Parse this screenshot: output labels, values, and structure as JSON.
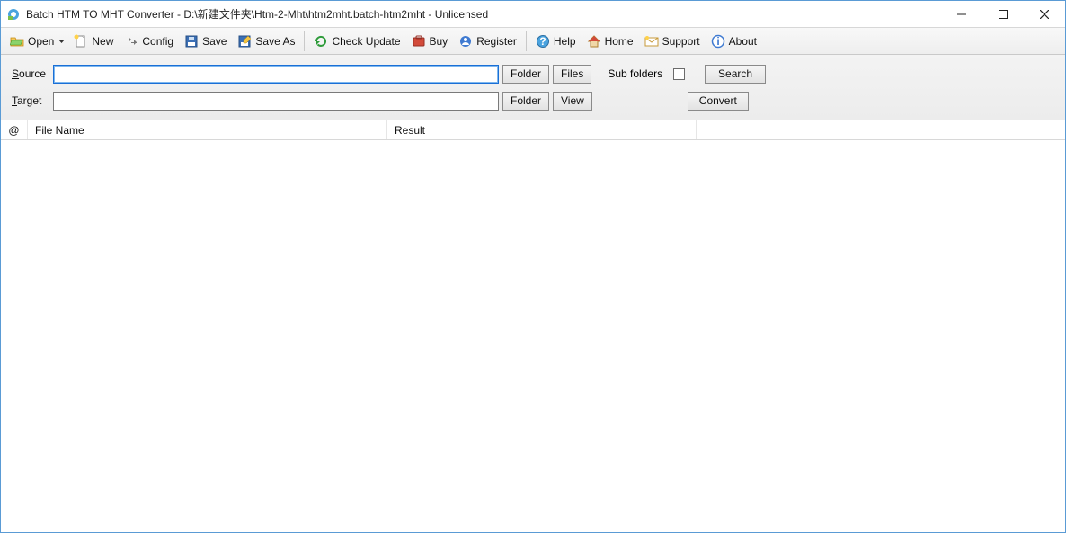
{
  "window": {
    "title": "Batch HTM TO MHT Converter - D:\\新建文件夹\\Htm-2-Mht\\htm2mht.batch-htm2mht - Unlicensed"
  },
  "toolbar": {
    "open": "Open",
    "new": "New",
    "config": "Config",
    "save": "Save",
    "save_as": "Save As",
    "check_update": "Check Update",
    "buy": "Buy",
    "register": "Register",
    "help": "Help",
    "home": "Home",
    "support": "Support",
    "about": "About"
  },
  "form": {
    "source_label_pre": "S",
    "source_label_post": "ource",
    "source_value": "",
    "target_label_pre": "T",
    "target_label_post": "arget",
    "target_value": "",
    "folder_btn": "Folder",
    "files_btn": "Files",
    "view_btn": "View",
    "subfolders_label": "Sub folders",
    "subfolders_checked": false,
    "search_btn": "Search",
    "convert_btn": "Convert"
  },
  "list": {
    "col_at": "@",
    "col_name": "File Name",
    "col_result": "Result",
    "rows": []
  }
}
